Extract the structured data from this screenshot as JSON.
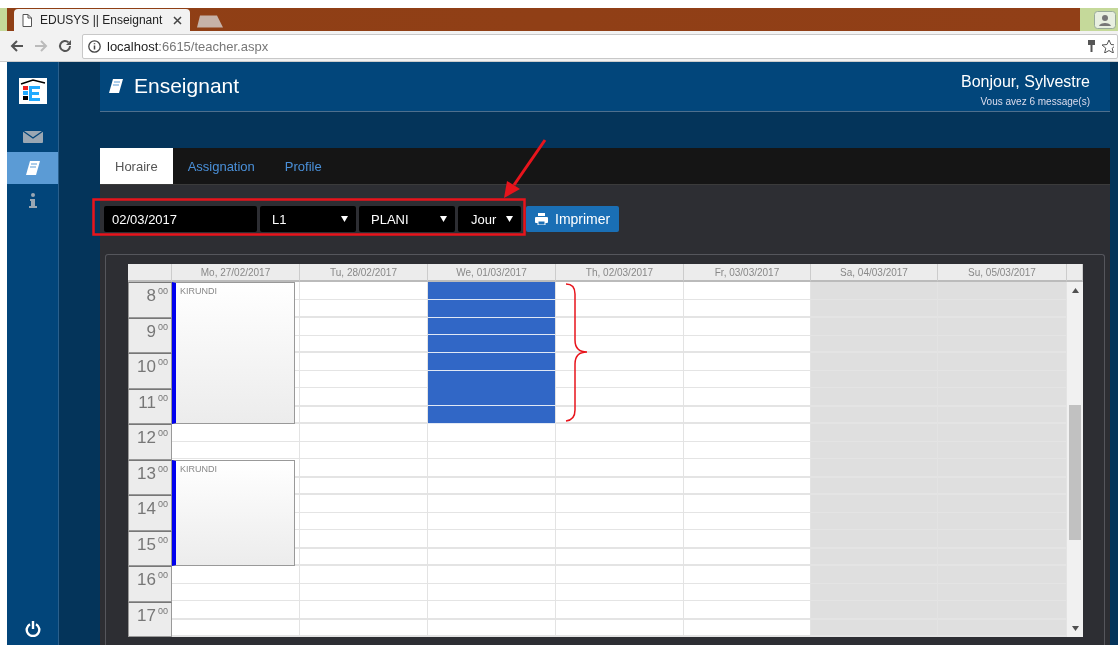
{
  "browser": {
    "tab_title": "EDUSYS || Enseignant",
    "url_host": "localhost",
    "url_rest": ":6615/teacher.aspx"
  },
  "sidebar": {
    "items": [
      {
        "kind": "mail",
        "selected": false
      },
      {
        "kind": "book",
        "selected": true
      },
      {
        "kind": "info",
        "selected": false
      },
      {
        "kind": "power",
        "selected": false
      }
    ]
  },
  "header": {
    "title": "Enseignant",
    "greeting": "Bonjour, Sylvestre",
    "messages": "Vous avez 6 message(s)"
  },
  "tabs": [
    {
      "label": "Horaire",
      "selected": true
    },
    {
      "label": "Assignation",
      "selected": false
    },
    {
      "label": "Profile",
      "selected": false
    }
  ],
  "toolbar": {
    "date": "02/03/2017",
    "selects": [
      "L1",
      "PLANI",
      "Jour"
    ],
    "print_button": "Imprimer"
  },
  "calendar": {
    "hours": [
      "8$^{00}$",
      "9$^{00}$",
      "10$^{00}$",
      "11$^{00}$",
      "12$^{00}$",
      "13$^{00}$",
      "14$^{00}$",
      "15$^{00}$",
      "16$^{00}$",
      "17$^{00}$"
    ],
    "days": [
      {
        "label": "Mo, 27/02/2017",
        "weekend": false,
        "slots": [
          {
            "kind": "event",
            "label": "KIRUNDI"
          },
          {
            "kind": "event"
          },
          {
            "kind": "event"
          },
          {
            "kind": "event"
          },
          {
            "kind": "free"
          },
          {
            "kind": "event",
            "label": "KIRUNDI"
          },
          {
            "kind": "event"
          },
          {
            "kind": "event"
          },
          {
            "kind": "free"
          },
          {
            "kind": "free"
          }
        ]
      },
      {
        "label": "Tu, 28/02/2017",
        "weekend": false,
        "slots": [
          {
            "kind": "free"
          },
          {
            "kind": "free"
          },
          {
            "kind": "free"
          },
          {
            "kind": "free"
          },
          {
            "kind": "free"
          },
          {
            "kind": "free"
          },
          {
            "kind": "free"
          },
          {
            "kind": "free"
          },
          {
            "kind": "free"
          },
          {
            "kind": "free"
          }
        ]
      },
      {
        "label": "We, 01/03/2017",
        "weekend": false,
        "slots": [
          {
            "kind": "selected"
          },
          {
            "kind": "selected"
          },
          {
            "kind": "selected"
          },
          {
            "kind": "selected"
          },
          {
            "kind": "free"
          },
          {
            "kind": "free"
          },
          {
            "kind": "free"
          },
          {
            "kind": "free"
          },
          {
            "kind": "free"
          },
          {
            "kind": "free"
          }
        ]
      },
      {
        "label": "Th, 02/03/2017",
        "weekend": false,
        "slots": [
          {
            "kind": "free"
          },
          {
            "kind": "free"
          },
          {
            "kind": "free"
          },
          {
            "kind": "free"
          },
          {
            "kind": "free"
          },
          {
            "kind": "free"
          },
          {
            "kind": "free"
          },
          {
            "kind": "free"
          },
          {
            "kind": "free"
          },
          {
            "kind": "free"
          }
        ]
      },
      {
        "label": "Fr, 03/03/2017",
        "weekend": false,
        "slots": [
          {
            "kind": "free"
          },
          {
            "kind": "free"
          },
          {
            "kind": "free"
          },
          {
            "kind": "free"
          },
          {
            "kind": "free"
          },
          {
            "kind": "free"
          },
          {
            "kind": "free"
          },
          {
            "kind": "free"
          },
          {
            "kind": "free"
          },
          {
            "kind": "free"
          }
        ]
      },
      {
        "label": "Sa, 04/03/2017",
        "weekend": true,
        "slots": [
          {
            "kind": "free"
          },
          {
            "kind": "free"
          },
          {
            "kind": "free"
          },
          {
            "kind": "free"
          },
          {
            "kind": "free"
          },
          {
            "kind": "free"
          },
          {
            "kind": "free"
          },
          {
            "kind": "free"
          },
          {
            "kind": "free"
          },
          {
            "kind": "free"
          }
        ]
      },
      {
        "label": "Su, 05/03/2017",
        "weekend": true,
        "slots": [
          {
            "kind": "free"
          },
          {
            "kind": "free"
          },
          {
            "kind": "free"
          },
          {
            "kind": "free"
          },
          {
            "kind": "free"
          },
          {
            "kind": "free"
          },
          {
            "kind": "free"
          },
          {
            "kind": "free"
          },
          {
            "kind": "free"
          },
          {
            "kind": "free"
          }
        ]
      }
    ]
  }
}
